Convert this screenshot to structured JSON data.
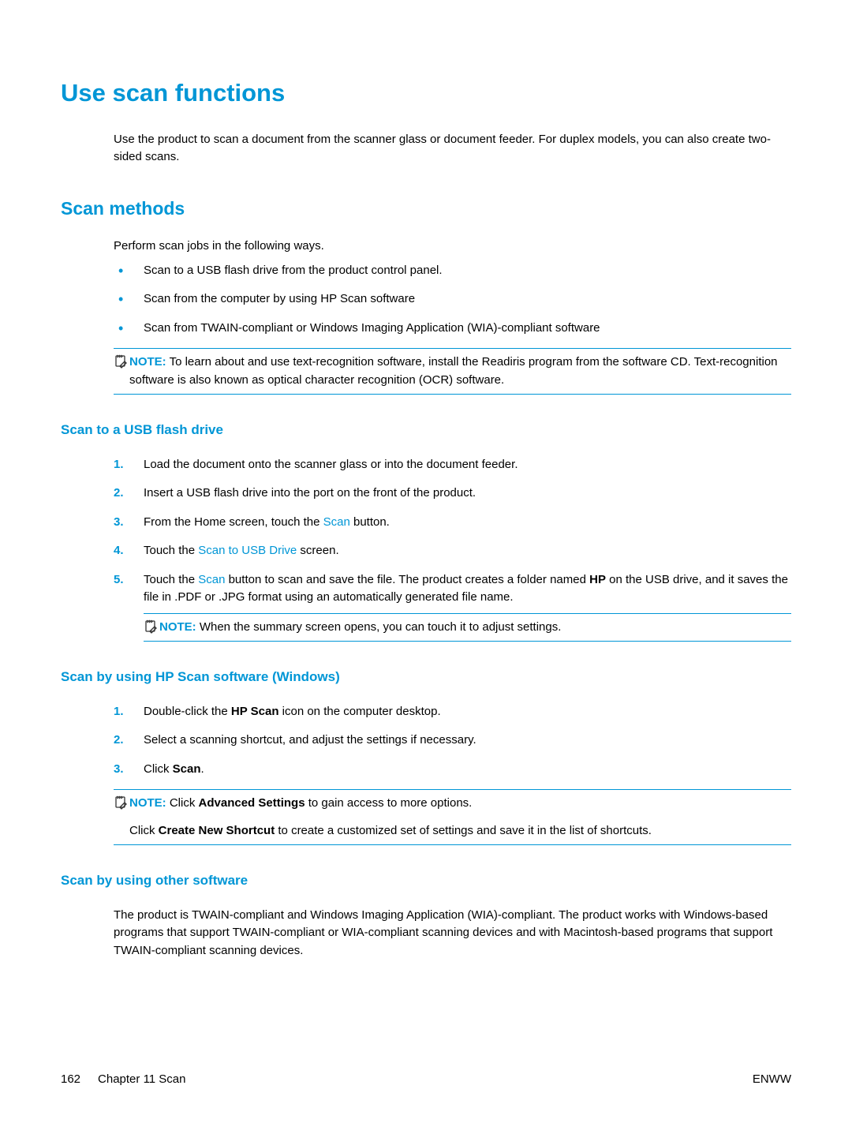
{
  "h1": "Use scan functions",
  "intro": "Use the product to scan a document from the scanner glass or document feeder. For duplex models, you can also create two-sided scans.",
  "h2": "Scan methods",
  "methods_intro": "Perform scan jobs in the following ways.",
  "methods": {
    "items": [
      "Scan to a USB flash drive from the product control panel.",
      "Scan from the computer by using HP Scan software",
      "Scan from TWAIN-compliant or Windows Imaging Application (WIA)-compliant software"
    ]
  },
  "note1": {
    "label": "NOTE:",
    "text": "To learn about and use text-recognition software, install the Readiris program from the software CD. Text-recognition software is also known as optical character recognition (OCR) software."
  },
  "usb": {
    "heading": "Scan to a USB flash drive",
    "steps": {
      "s1": {
        "num": "1.",
        "text": "Load the document onto the scanner glass or into the document feeder."
      },
      "s2": {
        "num": "2.",
        "text": "Insert a USB flash drive into the port on the front of the product."
      },
      "s3": {
        "num": "3.",
        "pre": "From the Home screen, touch the ",
        "link": "Scan",
        "post": " button."
      },
      "s4": {
        "num": "4.",
        "pre": "Touch the ",
        "link": "Scan to USB Drive",
        "post": " screen."
      },
      "s5": {
        "num": "5.",
        "pre": "Touch the ",
        "link": "Scan",
        "mid1": " button to scan and save the file. The product creates a folder named ",
        "bold": "HP",
        "post": " on the USB drive, and it saves the file in .PDF or .JPG format using an automatically generated file name."
      }
    },
    "note": {
      "label": "NOTE:",
      "text": "When the summary screen opens, you can touch it to adjust settings."
    }
  },
  "hpscan": {
    "heading": "Scan by using HP Scan software (Windows)",
    "steps": {
      "s1": {
        "num": "1.",
        "pre": "Double-click the ",
        "bold": "HP Scan",
        "post": " icon on the computer desktop."
      },
      "s2": {
        "num": "2.",
        "text": "Select a scanning shortcut, and adjust the settings if necessary."
      },
      "s3": {
        "num": "3.",
        "pre": "Click ",
        "bold": "Scan",
        "post": "."
      }
    },
    "note": {
      "label": "NOTE:",
      "text_pre": "Click ",
      "text_bold": "Advanced Settings",
      "text_post": " to gain access to more options.",
      "cont_pre": "Click ",
      "cont_bold": "Create New Shortcut",
      "cont_post": " to create a customized set of settings and save it in the list of shortcuts."
    }
  },
  "other": {
    "heading": "Scan by using other software",
    "para": "The product is TWAIN-compliant and Windows Imaging Application (WIA)-compliant. The product works with Windows-based programs that support TWAIN-compliant or WIA-compliant scanning devices and with Macintosh-based programs that support TWAIN-compliant scanning devices."
  },
  "footer": {
    "page_num": "162",
    "chapter": "Chapter 11   Scan",
    "right": "ENWW"
  }
}
